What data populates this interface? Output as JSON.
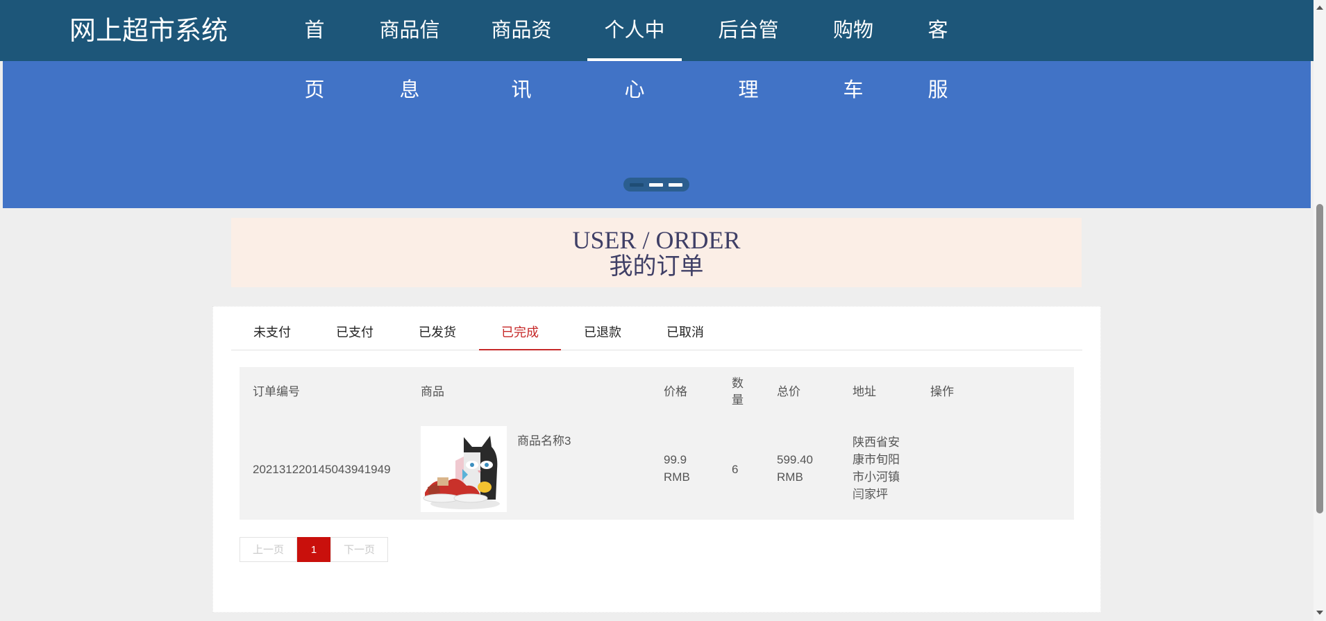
{
  "header": {
    "brand": "网上超市系统",
    "nav": [
      {
        "label": "首页"
      },
      {
        "label": "商品信息"
      },
      {
        "label": "商品资讯"
      },
      {
        "label": "个人中心"
      },
      {
        "label": "后台管理"
      },
      {
        "label": "购物车"
      },
      {
        "label": "客服"
      }
    ],
    "active_nav": "个人中心"
  },
  "banner": {
    "background_color": "#4173c6",
    "carousel_slides": 3,
    "active_slide": 1
  },
  "section_title": {
    "en": "USER / ORDER",
    "cn": "我的订单"
  },
  "tabs": {
    "items": [
      {
        "label": "未支付"
      },
      {
        "label": "已支付"
      },
      {
        "label": "已发货"
      },
      {
        "label": "已完成"
      },
      {
        "label": "已退款"
      },
      {
        "label": "已取消"
      }
    ],
    "active": "已完成"
  },
  "orders": {
    "columns": {
      "order_no": "订单编号",
      "product": "商品",
      "price": "价格",
      "qty_line1": "数",
      "qty_line2": "量",
      "total": "总价",
      "address": "地址",
      "action": "操作"
    },
    "rows": [
      {
        "order_no": "20213122014504394194 9",
        "order_no_display": "202131220145043941949",
        "product_name": "商品名称3",
        "product_image_icon": "snack-product-photo",
        "price_value": "99.9",
        "price_unit": "RMB",
        "qty": "6",
        "total_value": "599.40",
        "total_unit": "RMB",
        "address_lines": [
          "陕西省安",
          "康市旬阳",
          "市小河镇",
          "闫家坪"
        ]
      }
    ]
  },
  "pagination": {
    "prev": "上一页",
    "current": "1",
    "next": "下一页"
  },
  "colors": {
    "navbar": "#1d5679",
    "accent_red": "#c62828",
    "page_button": "#c9100c",
    "title_bg": "#fbeee6"
  }
}
